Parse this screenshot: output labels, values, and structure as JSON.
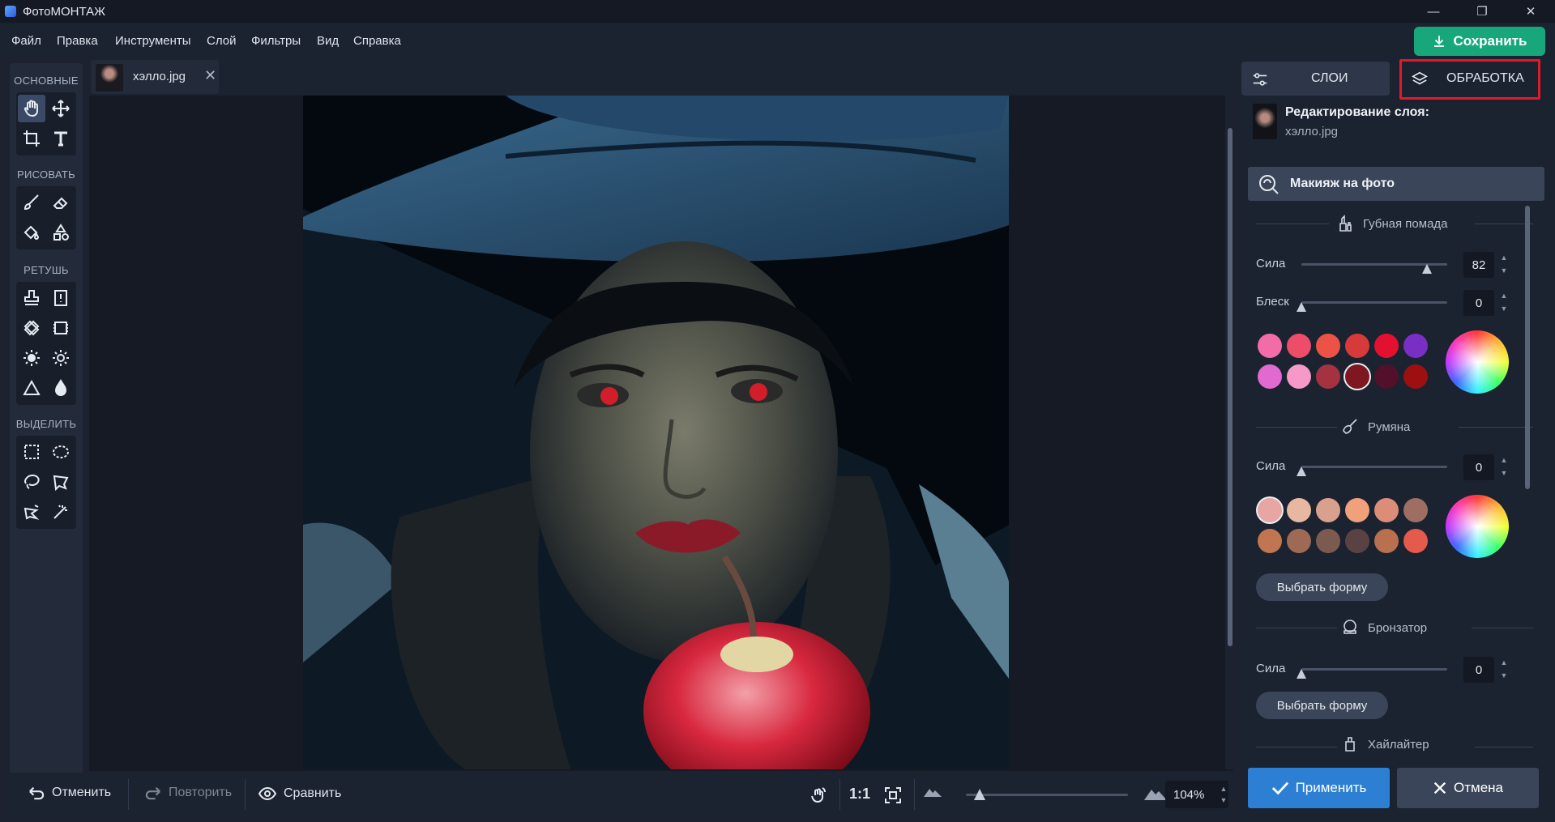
{
  "app": {
    "title": "ФотоМОНТАЖ"
  },
  "window": {
    "minimize": "—",
    "restore": "❐",
    "close": "✕"
  },
  "menu": [
    "Файл",
    "Правка",
    "Инструменты",
    "Слой",
    "Фильтры",
    "Вид",
    "Справка"
  ],
  "save_button": "Сохранить",
  "tools": {
    "sections": [
      "ОСНОВНЫЕ",
      "РИСОВАТЬ",
      "РЕТУШЬ",
      "ВЫДЕЛИТЬ"
    ]
  },
  "file_tab": {
    "name": "хэлло.jpg"
  },
  "bottom": {
    "undo": "Отменить",
    "redo": "Повторить",
    "compare": "Сравнить",
    "ratio": "1:1",
    "zoom": "104%"
  },
  "panel": {
    "tabs": [
      "СЛОИ",
      "ОБРАБОТКА"
    ],
    "active_tab": "ОБРАБОТКА",
    "layer_title": "Редактирование слоя:",
    "layer_file": "хэлло.jpg",
    "makeup_title": "Макияж на фото",
    "lipstick": {
      "title": "Губная помада",
      "strength_label": "Сила",
      "strength": "82",
      "gloss_label": "Блеск",
      "gloss": "0",
      "colors": [
        "#f26da8",
        "#ee4d6a",
        "#ec5346",
        "#d63a3a",
        "#e3102f",
        "#7a2fc4",
        "#e06ad0",
        "#f59ac8",
        "#a53240",
        "#7e1720",
        "#52102a",
        "#9e0f12"
      ]
    },
    "blush": {
      "title": "Румяна",
      "strength_label": "Сила",
      "strength": "0",
      "colors": [
        "#e7a6a4",
        "#e8b7a1",
        "#d9a08e",
        "#f0a07a",
        "#db8d78",
        "#9e6e62",
        "#c07650",
        "#9e6a55",
        "#7d5a50",
        "#5a4243",
        "#b8704e",
        "#e45a4c"
      ],
      "shape_button": "Выбрать форму"
    },
    "bronzer": {
      "title": "Бронзатор",
      "strength_label": "Сила",
      "strength": "0",
      "shape_button": "Выбрать форму"
    },
    "highlighter": {
      "title": "Хайлайтер"
    },
    "apply": "Применить",
    "cancel": "Отмена"
  }
}
